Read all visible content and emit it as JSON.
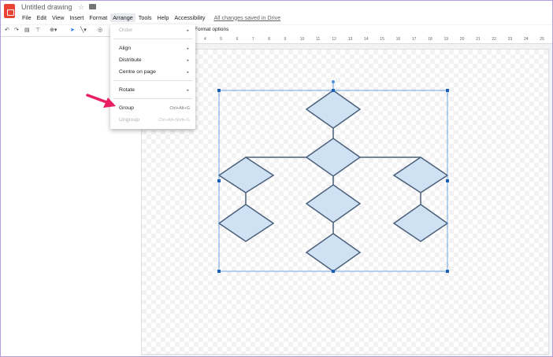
{
  "document": {
    "title": "Untitled drawing"
  },
  "menu": {
    "file": "File",
    "edit": "Edit",
    "view": "View",
    "insert": "Insert",
    "format": "Format",
    "arrange": "Arrange",
    "tools": "Tools",
    "help": "Help",
    "accessibility": "Accessibility",
    "save_status": "All changes saved in Drive"
  },
  "toolbar": {
    "format_options": "Format options"
  },
  "ruler": {
    "marks": [
      "4",
      "5",
      "6",
      "7",
      "8",
      "9",
      "10",
      "11",
      "12",
      "13",
      "14",
      "15",
      "16",
      "17",
      "18",
      "19",
      "20",
      "21",
      "22",
      "23",
      "24",
      "25"
    ]
  },
  "arrange_menu": {
    "order": "Order",
    "align": "Align",
    "distribute": "Distribute",
    "centre_on_page": "Centre on page",
    "rotate": "Rotate",
    "group": "Group",
    "group_shortcut": "Ctrl+Alt+G",
    "ungroup": "Ungroup",
    "ungroup_shortcut": "Ctrl+Alt+Shift+G"
  },
  "colors": {
    "diamond_fill": "#cfe2f3",
    "diamond_stroke": "#4a5f7a",
    "selection": "#4a90d9",
    "arrow": "#e91e63"
  }
}
